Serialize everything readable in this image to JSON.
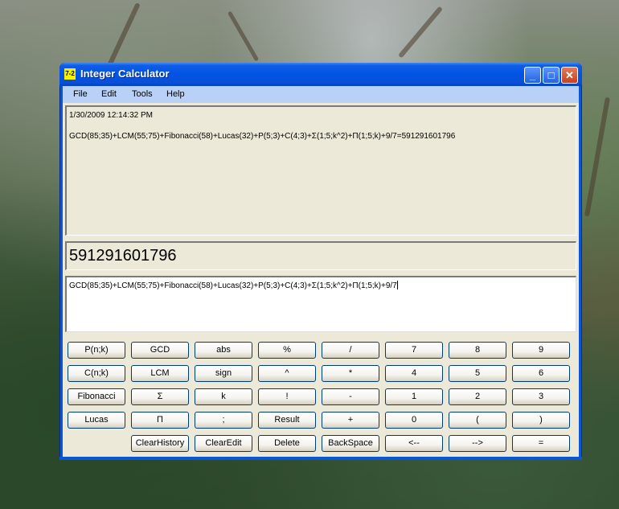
{
  "window": {
    "title": "Integer Calculator",
    "icon_text": "7-2"
  },
  "title_buttons": {
    "minimize": "_",
    "maximize": "□",
    "close": "✕"
  },
  "menu": [
    "File",
    "Edit",
    "Tools",
    "Help"
  ],
  "history": {
    "timestamp": "1/30/2009 12:14:32 PM",
    "entry": "GCD(85;35)+LCM(55;75)+Fibonacci(58)+Lucas(32)+P(5;3)+C(4;3)+Σ(1;5;k^2)+Π(1;5;k)+9/7=591291601796"
  },
  "result": "591291601796",
  "edit_text": "GCD(85;35)+LCM(55;75)+Fibonacci(58)+Lucas(32)+P(5;3)+C(4;3)+Σ(1;5;k^2)+Π(1;5;k)+9/7",
  "keys": {
    "row1": [
      "P(n;k)",
      "GCD",
      "abs",
      "%",
      "/",
      "7",
      "8",
      "9"
    ],
    "row2": [
      "C(n;k)",
      "LCM",
      "sign",
      "^",
      "*",
      "4",
      "5",
      "6"
    ],
    "row3": [
      "Fibonacci",
      "Σ",
      "k",
      "!",
      "-",
      "1",
      "2",
      "3"
    ],
    "row4": [
      "Lucas",
      "Π",
      ";",
      "Result",
      "+",
      "0",
      "(",
      ")"
    ],
    "row5": [
      "ClearHistory",
      "ClearEdit",
      "Delete",
      "BackSpace",
      "<--",
      "-->",
      "="
    ]
  },
  "colors": {
    "titlebar": "#0054e3",
    "client": "#ece9d8",
    "menubar": "#b9d1f7",
    "key_border": "#003c74"
  }
}
